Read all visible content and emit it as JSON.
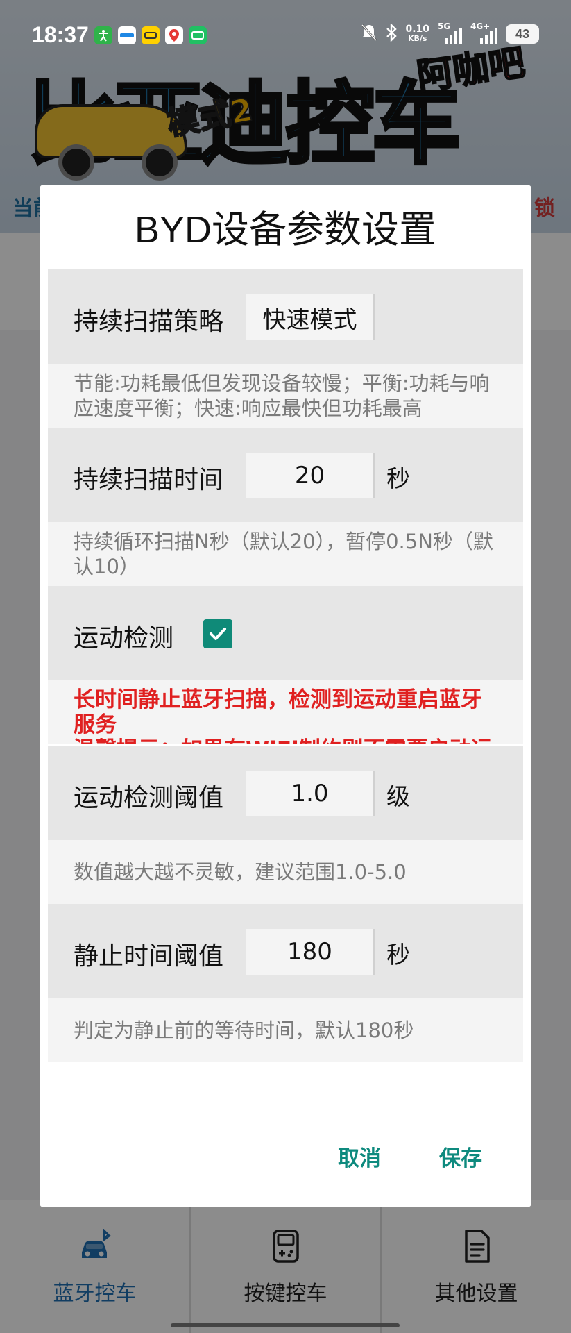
{
  "status_bar": {
    "time": "18:37",
    "net_speed_value": "0.10",
    "net_speed_unit": "KB/s",
    "signal1_label": "5G",
    "signal2_label": "4G+",
    "battery": "43"
  },
  "background": {
    "banner_title": "比亚迪控车",
    "banner_brand": "阿咖吧",
    "banner_mode": "模式2",
    "left_text": "当前",
    "right_text": "锁"
  },
  "dialog": {
    "title": "BYD设备参数设置",
    "scan_strategy": {
      "label": "持续扫描策略",
      "value": "快速模式",
      "desc": "节能:功耗最低但发现设备较慢；平衡:功耗与响应速度平衡；快速:响应最快但功耗最高"
    },
    "scan_time": {
      "label": "持续扫描时间",
      "value": "20",
      "unit": "秒",
      "desc": "持续循环扫描N秒（默认20），暂停0.5N秒（默认10）"
    },
    "motion_detect": {
      "label": "运动检测",
      "checked": true,
      "desc_line1": "长时间静止蓝牙扫描，检测到运动重启蓝牙服务",
      "desc_line2": "温馨提示：如果有WiFi制约则不需要启动运动"
    },
    "motion_threshold": {
      "label": "运动检测阈值",
      "value": "1.0",
      "unit": "级",
      "desc": "数值越大越不灵敏，建议范围1.0-5.0"
    },
    "still_threshold": {
      "label": "静止时间阈值",
      "value": "180",
      "unit": "秒",
      "desc": "判定为静止前的等待时间，默认180秒"
    },
    "cancel_label": "取消",
    "save_label": "保存"
  },
  "bottom_nav": {
    "items": [
      {
        "label": "蓝牙控车",
        "icon": "bluetooth-car-icon",
        "active": true
      },
      {
        "label": "按键控车",
        "icon": "gamepad-icon",
        "active": false
      },
      {
        "label": "其他设置",
        "icon": "document-icon",
        "active": false
      }
    ]
  },
  "colors": {
    "accent": "#0e8a7e",
    "warning": "#e02020",
    "active_nav": "#1f6fb2"
  }
}
